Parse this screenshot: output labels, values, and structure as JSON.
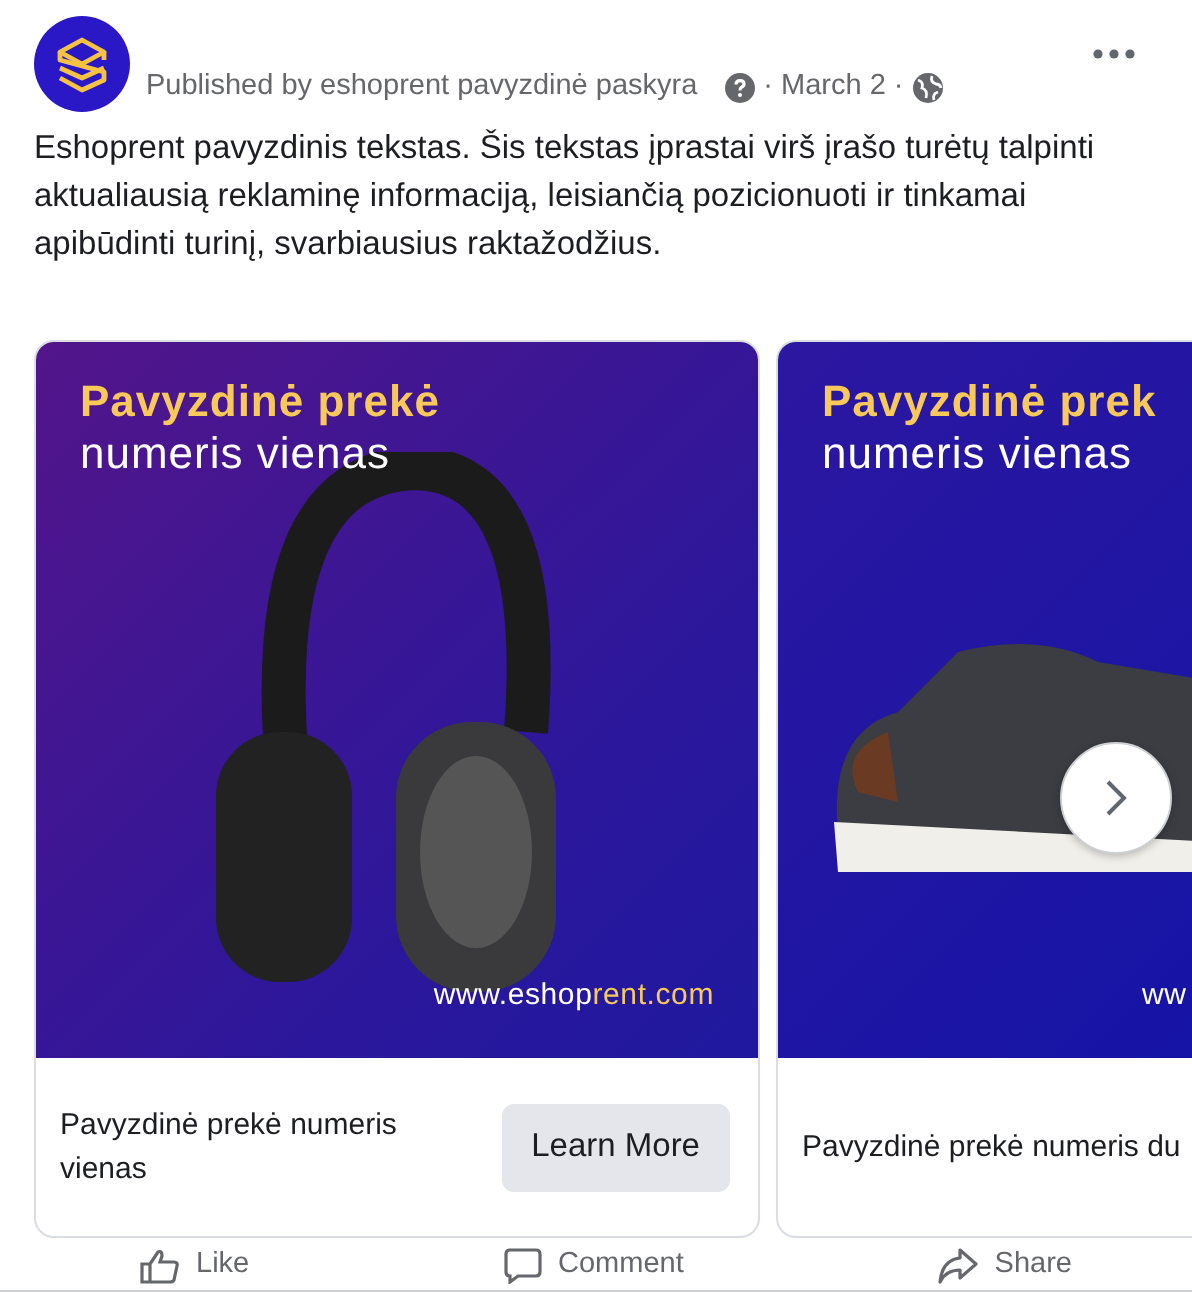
{
  "post": {
    "publisher": "Published by eshoprent pavyzdinė paskyra",
    "date_separators": [
      "·",
      "·"
    ],
    "date": "March 2",
    "body": "Eshoprent pavyzdinis tekstas. Šis tekstas įprastai virš įrašo turėtų talpinti aktualiausią reklaminę informaciją, leisiančią pozicionuoti ir tinkamai apibūdinti turinį, svarbiausius raktažodžius."
  },
  "cards": [
    {
      "kind": "headphones",
      "title_line_1": "Pavyzdinė prekė",
      "title_line_2": "numeris vienas",
      "url": "www.eshop",
      "url_accent": "rent.com",
      "caption": "Pavyzdinė prekė numeris vienas",
      "button": "Learn More"
    },
    {
      "kind": "shoes",
      "title_line_1": "Pavyzdinė prek",
      "title_line_2": "numeris vienas",
      "url": "ww",
      "caption": "Pavyzdinė prekė numeris du"
    }
  ],
  "actions": [
    "Like",
    "Comment",
    "Share"
  ]
}
